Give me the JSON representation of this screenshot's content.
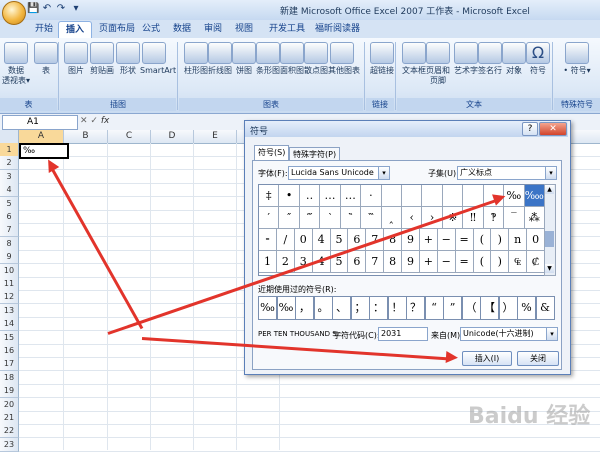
{
  "window": {
    "title": "新建 Microsoft Office Excel 2007 工作表 - Microsoft Excel"
  },
  "tabs": [
    "开始",
    "插入",
    "页面布局",
    "公式",
    "数据",
    "审阅",
    "视图",
    "开发工具",
    "福昕阅读器"
  ],
  "ribbon": {
    "items": [
      [
        "数据",
        "透视表▾"
      ],
      [
        "表"
      ],
      [
        "图片"
      ],
      [
        "剪贴画"
      ],
      [
        "形状"
      ],
      [
        "SmartArt"
      ],
      [
        "柱形图"
      ],
      [
        "折线图"
      ],
      [
        "饼图"
      ],
      [
        "条形图"
      ],
      [
        "面积图"
      ],
      [
        "散点图"
      ],
      [
        "其他图表"
      ],
      [
        "超链接"
      ],
      [
        "文本框"
      ],
      [
        "页眉和",
        "页脚"
      ],
      [
        "艺术字"
      ],
      [
        "签名行"
      ],
      [
        "对象"
      ],
      [
        "符号"
      ],
      [
        "• 符号▾"
      ]
    ],
    "groups": [
      "表",
      "插图",
      "图表",
      "链接",
      "文本",
      "特殊符号"
    ]
  },
  "formula_bar": {
    "name_box": "A1",
    "fx": "fx",
    "content": ""
  },
  "columns": [
    "A",
    "B",
    "C",
    "D",
    "E"
  ],
  "rows": [
    "1",
    "2",
    "3",
    "4",
    "5",
    "6",
    "7",
    "8",
    "9",
    "10",
    "11",
    "12",
    "13",
    "14",
    "15",
    "16",
    "17",
    "18",
    "19",
    "20",
    "21",
    "22",
    "23"
  ],
  "cell_a1": "‰",
  "dialog": {
    "title": "符号",
    "help": "?",
    "close": "✕",
    "tabs": [
      "符号(S)",
      "特殊字符(P)"
    ],
    "font_label": "字体(F):",
    "font_value": "Lucida Sans Unicode",
    "subset_label": "子集(U):",
    "subset_value": "广义标点",
    "grid": [
      [
        "‡",
        "•",
        "‥",
        "…",
        "…",
        "·",
        "",
        "",
        "",
        "",
        "",
        "",
        "‰",
        "‱"
      ],
      [
        "′",
        "″",
        "‴",
        "‵",
        "‶",
        "‷",
        "‸",
        "‹",
        "›",
        "※",
        "‼",
        "‽",
        "‾",
        "⁂"
      ],
      [
        "⁃",
        "/",
        "0",
        "4",
        "5",
        "6",
        "7",
        "8",
        "9",
        "+",
        "−",
        "=",
        "(",
        ")",
        "n",
        "0"
      ],
      [
        "1",
        "2",
        "3",
        "4",
        "5",
        "6",
        "7",
        "8",
        "9",
        "+",
        "−",
        "=",
        "(",
        ")",
        "₠",
        "₡"
      ]
    ],
    "recent_label": "近期使用过的符号(R):",
    "recent": [
      "‰",
      "‰",
      "，",
      "。",
      "、",
      "；",
      "：",
      "！",
      "？",
      "“",
      "”",
      "（",
      "【",
      "）",
      "%",
      "&"
    ],
    "char_name": "PER TEN THOUSAND S…",
    "code_label": "字符代码(C):",
    "code_value": "2031",
    "from_label": "来自(M):",
    "from_value": "Unicode(十六进制)",
    "insert_button": "插入(I)",
    "cancel_button": "关闭"
  },
  "watermark": "Baidu 经验"
}
